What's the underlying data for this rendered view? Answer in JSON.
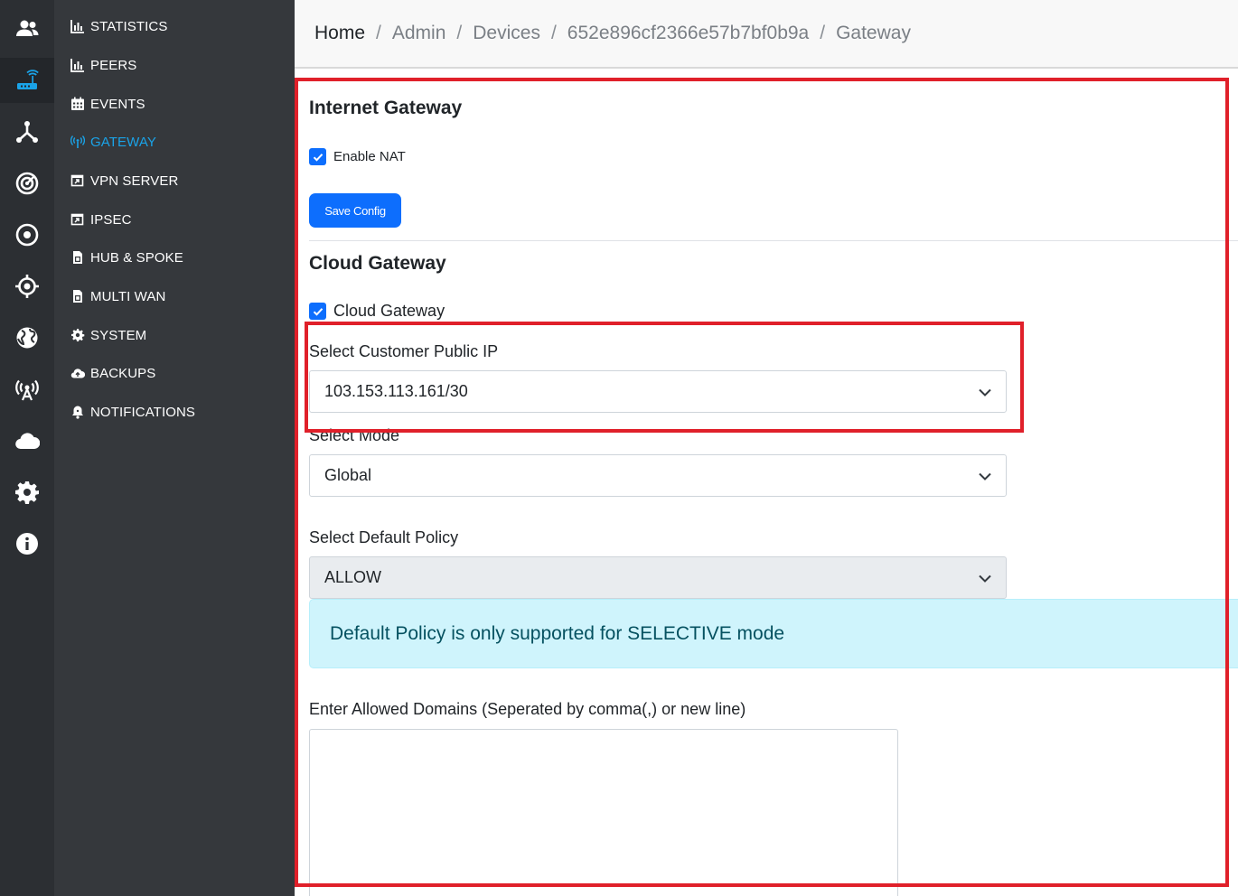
{
  "rail": {
    "items": [
      {
        "icon": "users-icon",
        "active": false
      },
      {
        "icon": "router-icon",
        "active": true
      },
      {
        "icon": "network-icon",
        "active": false
      },
      {
        "icon": "radar-icon",
        "active": false
      },
      {
        "icon": "target-icon",
        "active": false
      },
      {
        "icon": "crosshair-icon",
        "active": false
      },
      {
        "icon": "globe-icon",
        "active": false
      },
      {
        "icon": "broadcast-tower-icon",
        "active": false
      },
      {
        "icon": "cloud-icon",
        "active": false
      },
      {
        "icon": "gear-icon",
        "active": false
      },
      {
        "icon": "info-icon",
        "active": false
      }
    ]
  },
  "submenu": {
    "items": [
      {
        "label": "STATISTICS",
        "icon": "bar-chart-icon"
      },
      {
        "label": "PEERS",
        "icon": "bar-chart-icon"
      },
      {
        "label": "EVENTS",
        "icon": "calendar-icon"
      },
      {
        "label": "GATEWAY",
        "icon": "antenna-icon",
        "active": true
      },
      {
        "label": "VPN SERVER",
        "icon": "window-arrow-icon"
      },
      {
        "label": "IPSEC",
        "icon": "window-arrow-icon"
      },
      {
        "label": "HUB & SPOKE",
        "icon": "sim-card-icon"
      },
      {
        "label": "MULTI WAN",
        "icon": "sim-card-icon"
      },
      {
        "label": "SYSTEM",
        "icon": "gear-icon"
      },
      {
        "label": "BACKUPS",
        "icon": "cloud-upload-icon"
      },
      {
        "label": "NOTIFICATIONS",
        "icon": "bell-icon"
      }
    ]
  },
  "breadcrumb": {
    "home": "Home",
    "admin": "Admin",
    "devices": "Devices",
    "device_id": "652e896cf2366e57b7bf0b9a",
    "current": "Gateway",
    "separator": "/"
  },
  "internet_gateway": {
    "title": "Internet Gateway",
    "enable_nat_label": "Enable NAT",
    "enable_nat_checked": true,
    "save_label": "Save Config"
  },
  "cloud_gateway": {
    "title": "Cloud Gateway",
    "checkbox_label": "Cloud Gateway",
    "checkbox_checked": true,
    "public_ip_label": "Select Customer Public IP",
    "public_ip_value": "103.153.113.161/30",
    "mode_label": "Select Mode",
    "mode_value": "Global",
    "policy_label": "Select Default Policy",
    "policy_value": "ALLOW",
    "policy_alert": "Default Policy is only supported for SELECTIVE mode",
    "domains_label": "Enter Allowed Domains (Seperated by comma(,) or new line)",
    "domains_value": ""
  },
  "colors": {
    "accent": "#0d6efd",
    "active_menu": "#1aa3e8",
    "highlight": "#e0202a",
    "alert_bg": "#cff4fc",
    "alert_text": "#055160"
  }
}
